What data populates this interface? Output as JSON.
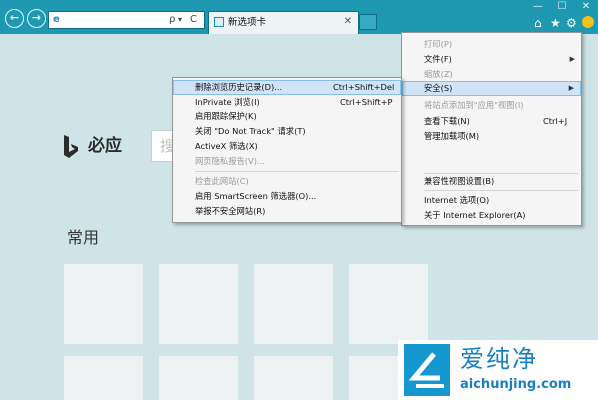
{
  "window_controls": [
    "—",
    "☐",
    "✕"
  ],
  "address_bar": {
    "value": "",
    "search_glyph": "ρ",
    "dropdown_glyph": "▾",
    "refresh_glyph": "C"
  },
  "tab": {
    "title": "新选项卡",
    "close_glyph": "✕"
  },
  "command_icons": [
    "home-icon",
    "star-icon",
    "gear-icon",
    "smiley-icon"
  ],
  "page": {
    "brand": "必应",
    "search_fragment": "搜",
    "section_title": "常用"
  },
  "tools_menu": {
    "items": [
      {
        "label": "打印(P)",
        "disabled": true,
        "submenu": false
      },
      {
        "label": "文件(F)",
        "disabled": false,
        "submenu": true
      },
      {
        "label": "缩放(Z)",
        "disabled": true,
        "submenu": false
      },
      {
        "label": "安全(S)",
        "disabled": false,
        "submenu": true
      },
      {
        "label": "将站点添加到\"应用\"视图(I)",
        "disabled": true,
        "submenu": false
      },
      {
        "label": "查看下载(N)",
        "shortcut": "Ctrl+J",
        "disabled": false,
        "submenu": false
      },
      {
        "label": "管理加载项(M)",
        "disabled": false,
        "submenu": false
      },
      {
        "label": "兼容性视图设置(B)",
        "disabled": false,
        "submenu": false
      },
      {
        "label": "Internet 选项(O)",
        "disabled": false,
        "submenu": false
      },
      {
        "label": "关于 Internet Explorer(A)",
        "disabled": false,
        "submenu": false
      }
    ]
  },
  "safety_menu": {
    "items": [
      {
        "label": "删除浏览历史记录(D)...",
        "shortcut": "Ctrl+Shift+Del",
        "disabled": false
      },
      {
        "label": "InPrivate 浏览(I)",
        "shortcut": "Ctrl+Shift+P",
        "disabled": false
      },
      {
        "label": "启用跟踪保护(K)",
        "disabled": false
      },
      {
        "label": "关闭 \"Do Not Track\" 请求(T)",
        "disabled": false
      },
      {
        "label": "ActiveX 筛选(X)",
        "disabled": false
      },
      {
        "label": "网页隐私报告(V)...",
        "disabled": true
      },
      {
        "label": "检查此网站(C)",
        "disabled": true
      },
      {
        "label": "启用 SmartScreen 筛选器(O)...",
        "disabled": false
      },
      {
        "label": "举报不安全网站(R)",
        "disabled": false
      }
    ]
  },
  "watermark": {
    "name": "爱纯净",
    "url": "aichunjing.com"
  },
  "colors": {
    "titlebar": "#1f98b1",
    "page_background": "#cfe4e6",
    "menu_highlight": "#cfe5f7",
    "watermark_blue": "#1a7fc1"
  }
}
